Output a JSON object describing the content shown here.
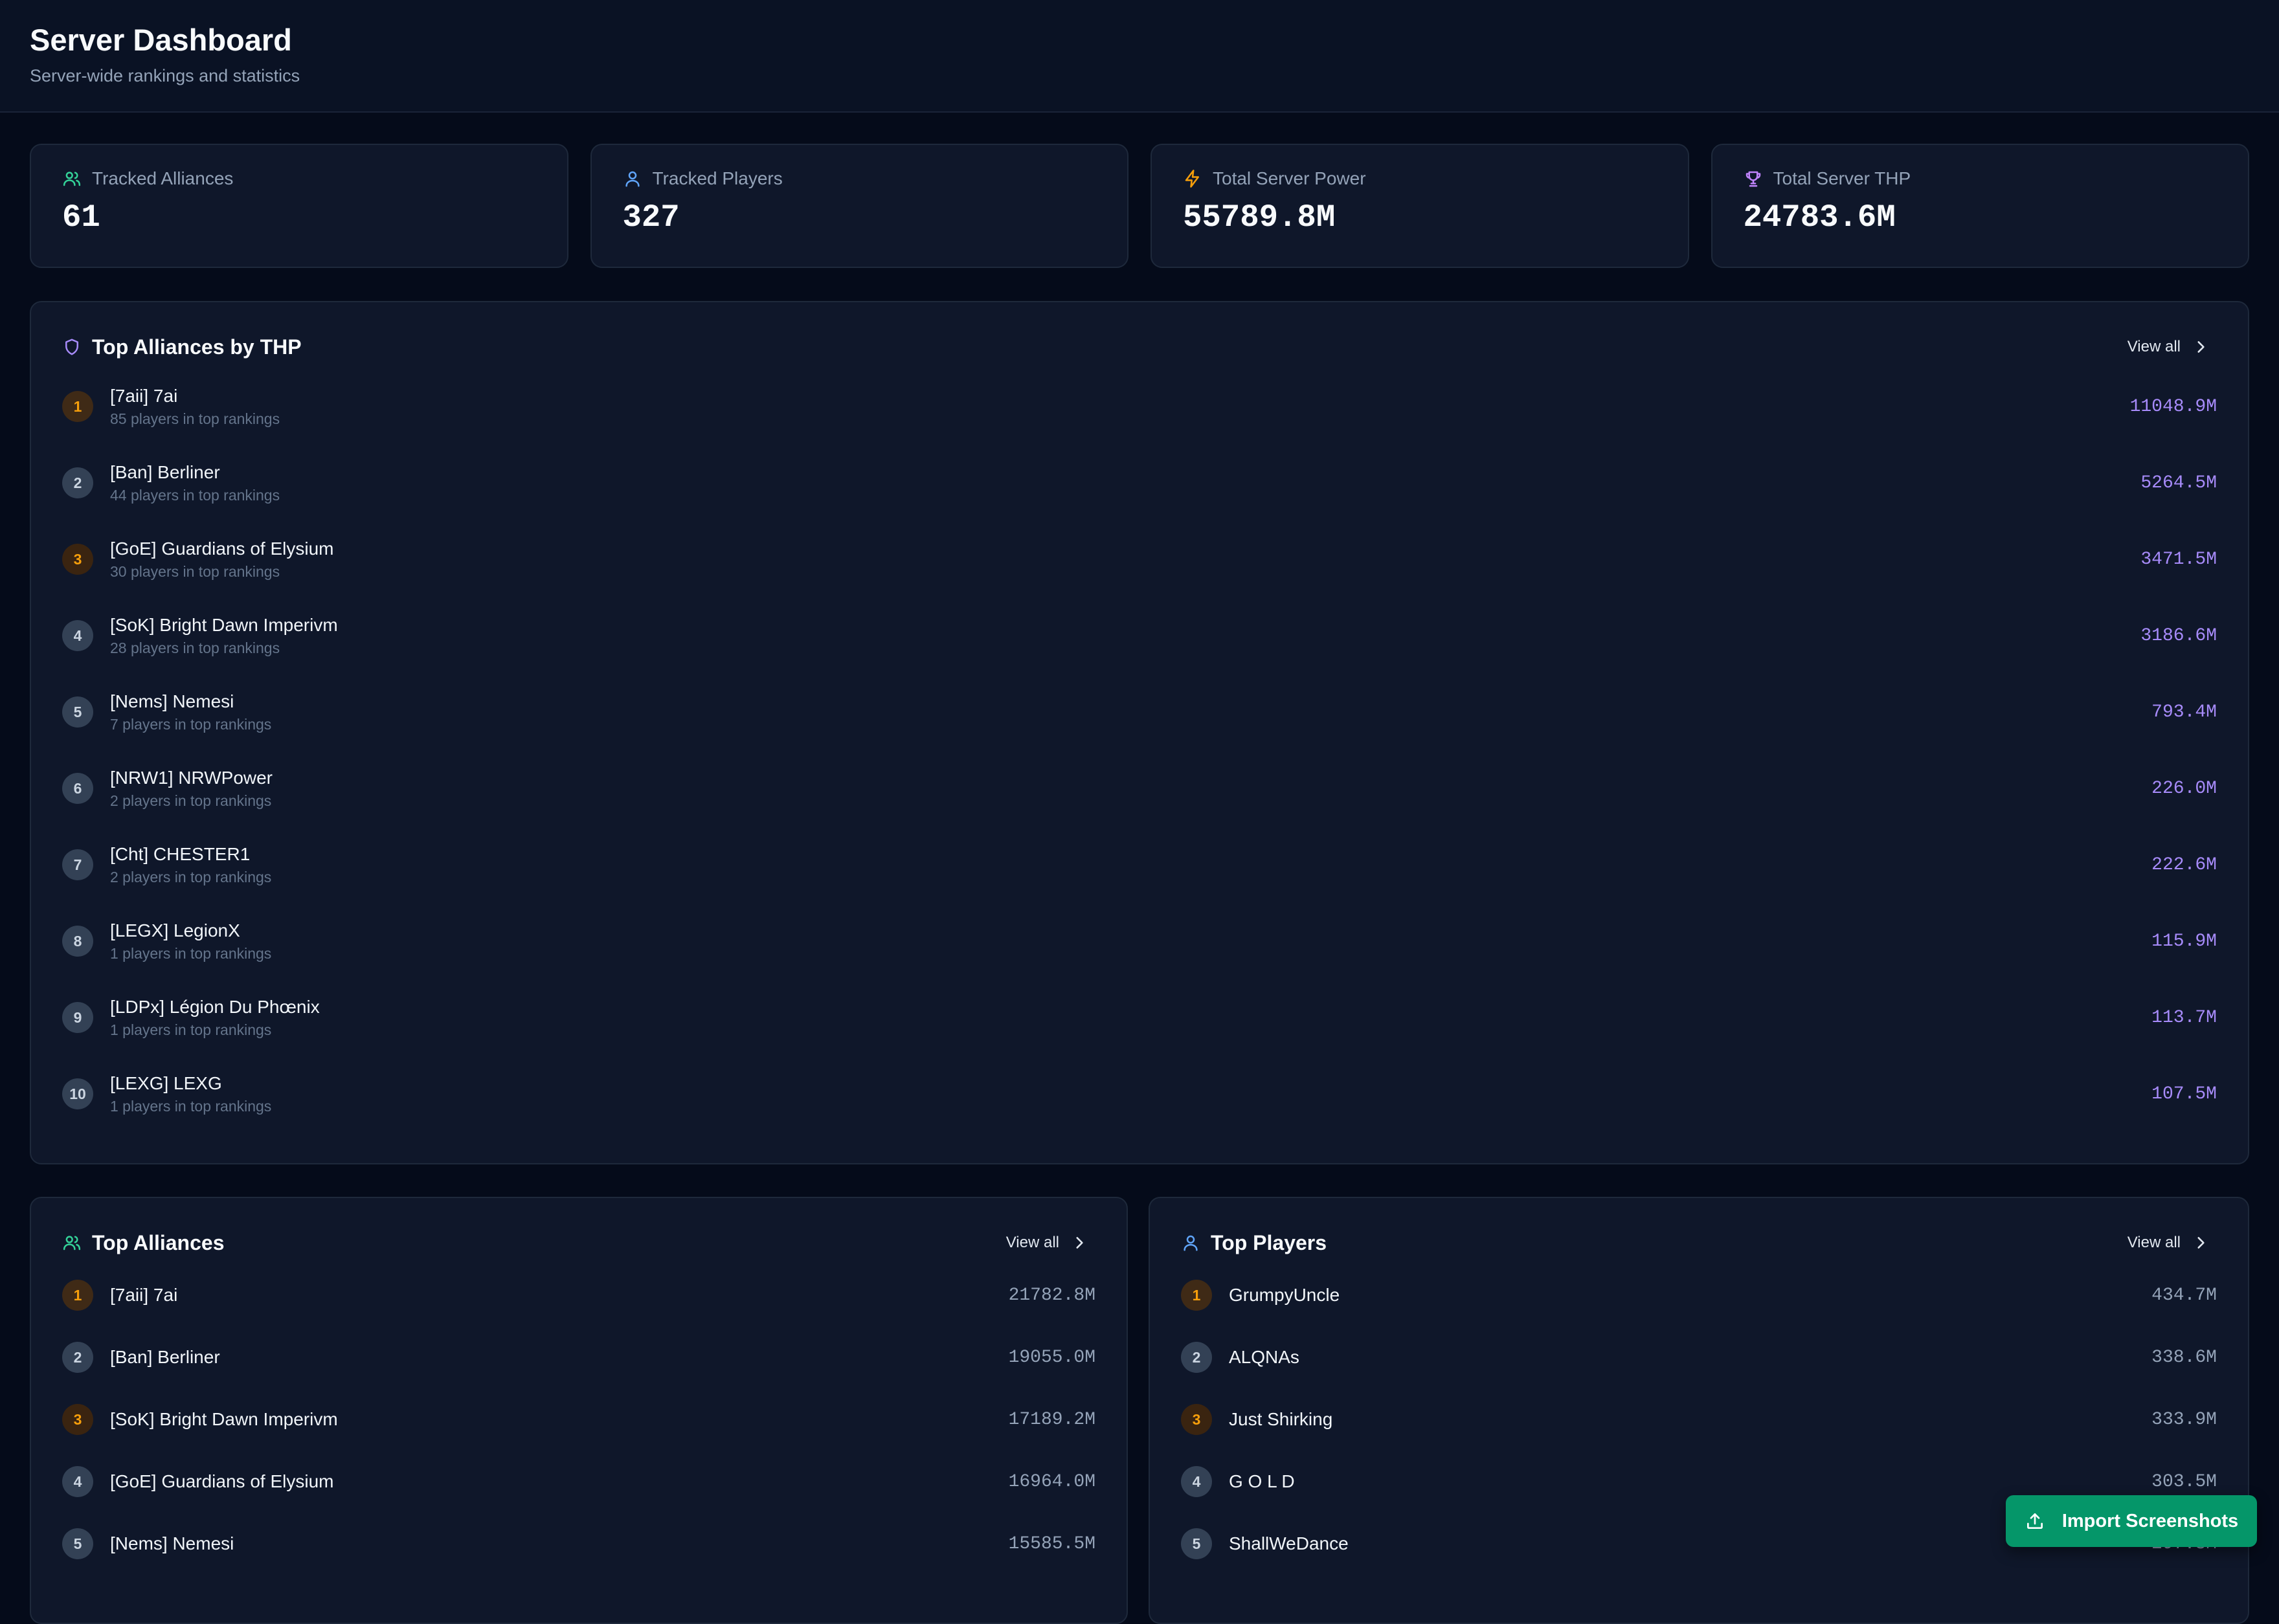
{
  "header": {
    "title": "Server Dashboard",
    "subtitle": "Server-wide rankings and statistics"
  },
  "stats": [
    {
      "label": "Tracked Alliances",
      "value": "61",
      "icon": "users-icon",
      "color": "#34d399"
    },
    {
      "label": "Tracked Players",
      "value": "327",
      "icon": "user-icon",
      "color": "#60a5fa"
    },
    {
      "label": "Total Server Power",
      "value": "55789.8M",
      "icon": "lightning-icon",
      "color": "#f59e0b"
    },
    {
      "label": "Total Server THP",
      "value": "24783.6M",
      "icon": "trophy-icon",
      "color": "#c084fc"
    }
  ],
  "thp_panel": {
    "title": "Top Alliances by THP",
    "view_all": "View all",
    "items": [
      {
        "rank": "1",
        "name": "[7aii] 7ai",
        "meta": "85 players in top rankings",
        "value": "11048.9M"
      },
      {
        "rank": "2",
        "name": "[Ban] Berliner",
        "meta": "44 players in top rankings",
        "value": "5264.5M"
      },
      {
        "rank": "3",
        "name": "[GoE] Guardians of Elysium",
        "meta": "30 players in top rankings",
        "value": "3471.5M"
      },
      {
        "rank": "4",
        "name": "[SoK] Bright Dawn Imperivm",
        "meta": "28 players in top rankings",
        "value": "3186.6M"
      },
      {
        "rank": "5",
        "name": "[Nems] Nemesi",
        "meta": "7 players in top rankings",
        "value": "793.4M"
      },
      {
        "rank": "6",
        "name": "[NRW1] NRWPower",
        "meta": "2 players in top rankings",
        "value": "226.0M"
      },
      {
        "rank": "7",
        "name": "[Cht] CHESTER1",
        "meta": "2 players in top rankings",
        "value": "222.6M"
      },
      {
        "rank": "8",
        "name": "[LEGX] LegionX",
        "meta": "1 players in top rankings",
        "value": "115.9M"
      },
      {
        "rank": "9",
        "name": "[LDPx] Légion Du Phœnix",
        "meta": "1 players in top rankings",
        "value": "113.7M"
      },
      {
        "rank": "10",
        "name": "[LEXG] LEXG",
        "meta": "1 players in top rankings",
        "value": "107.5M"
      }
    ]
  },
  "alliances_panel": {
    "title": "Top Alliances",
    "view_all": "View all",
    "items": [
      {
        "rank": "1",
        "name": "[7aii] 7ai",
        "value": "21782.8M"
      },
      {
        "rank": "2",
        "name": "[Ban] Berliner",
        "value": "19055.0M"
      },
      {
        "rank": "3",
        "name": "[SoK] Bright Dawn Imperivm",
        "value": "17189.2M"
      },
      {
        "rank": "4",
        "name": "[GoE] Guardians of Elysium",
        "value": "16964.0M"
      },
      {
        "rank": "5",
        "name": "[Nems] Nemesi",
        "value": "15585.5M"
      }
    ]
  },
  "players_panel": {
    "title": "Top Players",
    "view_all": "View all",
    "items": [
      {
        "rank": "1",
        "name": "GrumpyUncle",
        "value": "434.7M"
      },
      {
        "rank": "2",
        "name": "ALQNAs",
        "value": "338.6M"
      },
      {
        "rank": "3",
        "name": "Just Shirking",
        "value": "333.9M"
      },
      {
        "rank": "4",
        "name": "G O L D",
        "value": "303.5M"
      },
      {
        "rank": "5",
        "name": "ShallWeDance",
        "value": "297.8M"
      }
    ]
  },
  "import_button": {
    "label": "Import Screenshots",
    "icon": "upload-icon"
  },
  "colors": {
    "background": "#050b1a",
    "panel": "#0f172a",
    "accent_purple": "#a78bfa",
    "button_green": "#059669",
    "rank_top": "#f59e0b"
  }
}
